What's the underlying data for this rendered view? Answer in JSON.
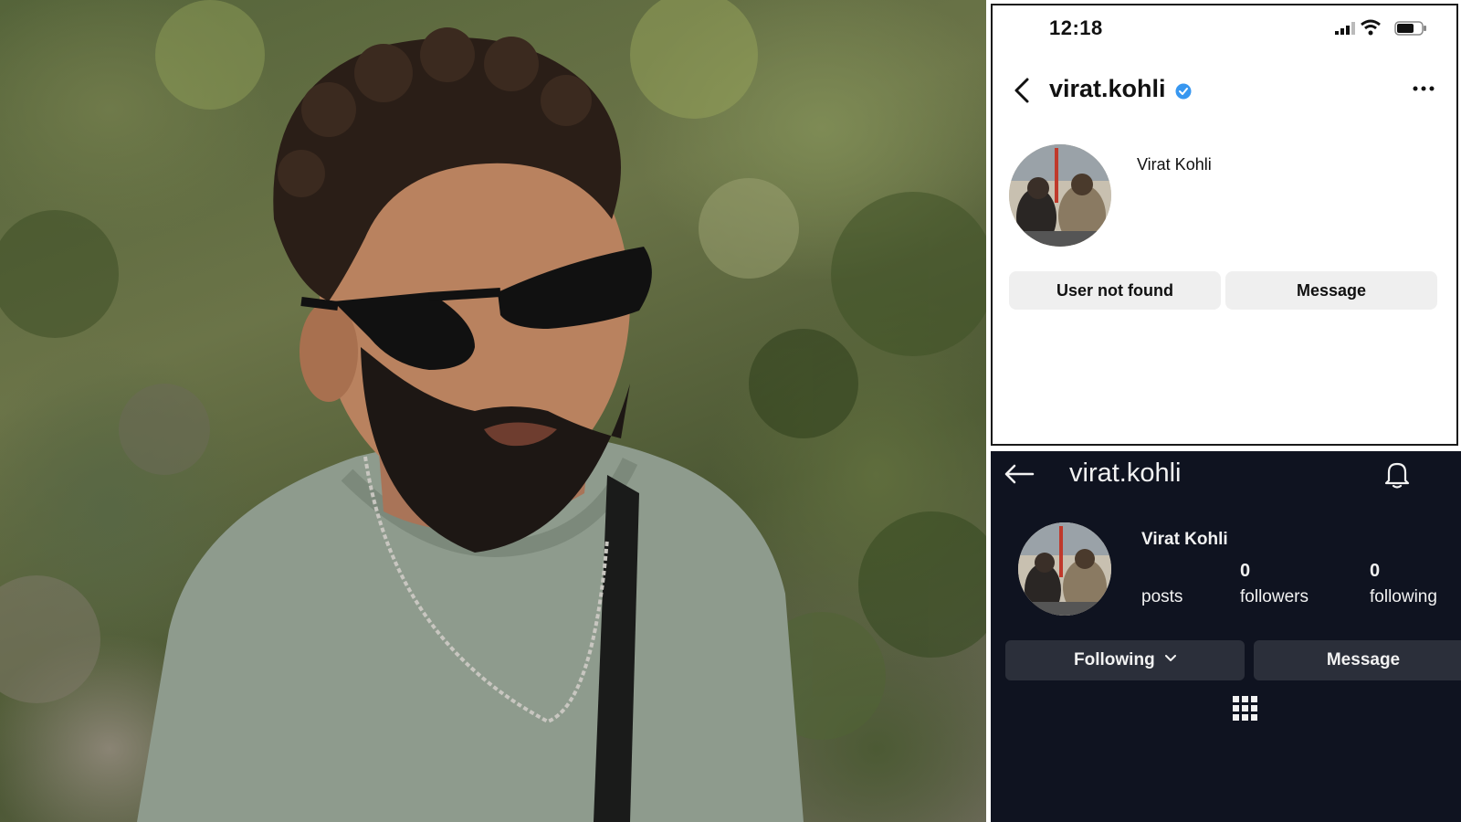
{
  "photo": {
    "subject": "portrait-photo"
  },
  "light_profile": {
    "status_time": "12:18",
    "username": "virat.kohli",
    "display_name": "Virat Kohli",
    "buttons": {
      "primary": "User not found",
      "message": "Message"
    },
    "icons": [
      "back-chevron-icon",
      "verified-badge-icon",
      "more-icon",
      "signal-icon",
      "wifi-icon",
      "battery-icon"
    ],
    "accent": "#3897f0"
  },
  "dark_profile": {
    "username": "virat.kohli",
    "display_name": "Virat Kohli",
    "stats": {
      "posts_label": "posts",
      "followers_value": "0",
      "followers_label": "followers",
      "following_value": "0",
      "following_label": "following"
    },
    "buttons": {
      "following": "Following",
      "message": "Message"
    },
    "icons": [
      "back-arrow-icon",
      "bell-icon",
      "chevron-down-icon",
      "grid-icon"
    ],
    "background": "#0f1320"
  }
}
